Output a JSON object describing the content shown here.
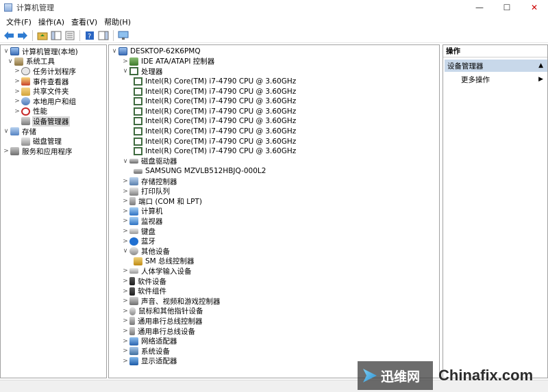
{
  "window": {
    "title": "计算机管理",
    "minimize": "—",
    "maximize": "☐",
    "close": "✕"
  },
  "menu": [
    "文件(F)",
    "操作(A)",
    "查看(V)",
    "帮助(H)"
  ],
  "left_tree": [
    {
      "label": "计算机管理(本地)",
      "expander": "∨",
      "icon": "computer-management-icon"
    },
    {
      "label": "系统工具",
      "expander": "∨",
      "icon": "system-tools-icon"
    },
    {
      "label": "任务计划程序",
      "expander": ">",
      "icon": "task-scheduler-icon"
    },
    {
      "label": "事件查看器",
      "expander": ">",
      "icon": "event-viewer-icon"
    },
    {
      "label": "共享文件夹",
      "expander": ">",
      "icon": "shared-folders-icon"
    },
    {
      "label": "本地用户和组",
      "expander": ">",
      "icon": "local-users-icon"
    },
    {
      "label": "性能",
      "expander": ">",
      "icon": "performance-icon"
    },
    {
      "label": "设备管理器",
      "expander": "",
      "icon": "device-manager-icon",
      "selected": true
    },
    {
      "label": "存储",
      "expander": "∨",
      "icon": "storage-icon"
    },
    {
      "label": "磁盘管理",
      "expander": "",
      "icon": "disk-management-icon"
    },
    {
      "label": "服务和应用程序",
      "expander": ">",
      "icon": "services-apps-icon"
    }
  ],
  "device_tree": [
    {
      "label": "DESKTOP-62K6PMQ",
      "expander": "∨",
      "icon": "computer-icon"
    },
    {
      "label": "IDE ATA/ATAPI 控制器",
      "expander": ">",
      "icon": "ide-controller-icon"
    },
    {
      "label": "处理器",
      "expander": "∨",
      "icon": "processor-icon"
    },
    {
      "label": "Intel(R) Core(TM) i7-4790 CPU @ 3.60GHz",
      "expander": "",
      "icon": "processor-icon"
    },
    {
      "label": "Intel(R) Core(TM) i7-4790 CPU @ 3.60GHz",
      "expander": "",
      "icon": "processor-icon"
    },
    {
      "label": "Intel(R) Core(TM) i7-4790 CPU @ 3.60GHz",
      "expander": "",
      "icon": "processor-icon"
    },
    {
      "label": "Intel(R) Core(TM) i7-4790 CPU @ 3.60GHz",
      "expander": "",
      "icon": "processor-icon"
    },
    {
      "label": "Intel(R) Core(TM) i7-4790 CPU @ 3.60GHz",
      "expander": "",
      "icon": "processor-icon"
    },
    {
      "label": "Intel(R) Core(TM) i7-4790 CPU @ 3.60GHz",
      "expander": "",
      "icon": "processor-icon"
    },
    {
      "label": "Intel(R) Core(TM) i7-4790 CPU @ 3.60GHz",
      "expander": "",
      "icon": "processor-icon"
    },
    {
      "label": "Intel(R) Core(TM) i7-4790 CPU @ 3.60GHz",
      "expander": "",
      "icon": "processor-icon"
    },
    {
      "label": "磁盘驱动器",
      "expander": "∨",
      "icon": "disk-drive-icon"
    },
    {
      "label": "SAMSUNG MZVLB512HBJQ-000L2",
      "expander": "",
      "icon": "disk-drive-icon"
    },
    {
      "label": "存储控制器",
      "expander": ">",
      "icon": "storage-controller-icon"
    },
    {
      "label": "打印队列",
      "expander": ">",
      "icon": "printer-icon"
    },
    {
      "label": "端口 (COM 和 LPT)",
      "expander": ">",
      "icon": "port-icon"
    },
    {
      "label": "计算机",
      "expander": ">",
      "icon": "computer-icon"
    },
    {
      "label": "监视器",
      "expander": ">",
      "icon": "monitor-icon"
    },
    {
      "label": "键盘",
      "expander": ">",
      "icon": "keyboard-icon"
    },
    {
      "label": "蓝牙",
      "expander": ">",
      "icon": "bluetooth-icon"
    },
    {
      "label": "其他设备",
      "expander": "∨",
      "icon": "other-devices-icon"
    },
    {
      "label": "SM 总线控制器",
      "expander": "",
      "icon": "warning-device-icon"
    },
    {
      "label": "人体学输入设备",
      "expander": ">",
      "icon": "hid-icon"
    },
    {
      "label": "软件设备",
      "expander": ">",
      "icon": "software-device-icon"
    },
    {
      "label": "软件组件",
      "expander": ">",
      "icon": "software-component-icon"
    },
    {
      "label": "声音、视频和游戏控制器",
      "expander": ">",
      "icon": "sound-icon"
    },
    {
      "label": "鼠标和其他指针设备",
      "expander": ">",
      "icon": "mouse-icon"
    },
    {
      "label": "通用串行总线控制器",
      "expander": ">",
      "icon": "usb-controller-icon"
    },
    {
      "label": "通用串行总线设备",
      "expander": ">",
      "icon": "usb-device-icon"
    },
    {
      "label": "网络适配器",
      "expander": ">",
      "icon": "network-adapter-icon"
    },
    {
      "label": "系统设备",
      "expander": ">",
      "icon": "system-device-icon"
    },
    {
      "label": "显示适配器",
      "expander": ">",
      "icon": "display-adapter-icon"
    }
  ],
  "actions": {
    "header": "操作",
    "section": "设备管理器",
    "section_arrow": "▲",
    "more": "更多操作",
    "more_arrow": "▶"
  },
  "watermark": {
    "cn": "迅维网",
    "en": "Chinafix.com"
  }
}
